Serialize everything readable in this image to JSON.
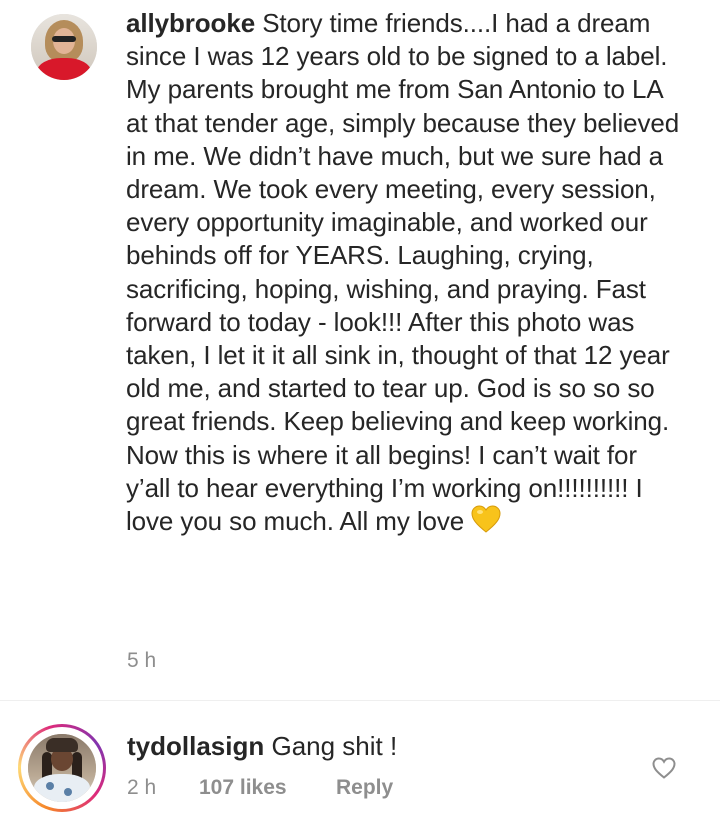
{
  "caption": {
    "username": "allybrooke",
    "text": "Story time friends....I had a dream since I was 12 years old to be signed to a label. My parents brought me from San Antonio to LA at that tender age, simply because they believed in me. We didn’t have much, but we sure had a dream. We took every meeting, every session, every opportunity imaginable, and worked our behinds off for YEARS. Laughing, crying, sacrificing, hoping, wishing, and praying. Fast forward to today - look!!! After this photo was taken, I let it it all sink in, thought of that 12 year old me, and started to tear up. God is so so so great friends. Keep believing and keep working. Now this is where it all begins! I can’t wait for y’all to hear everything I’m working on!!!!!!!!!! I love you so much. All my love",
    "emoji": "yellow-heart-icon",
    "time": "5 h",
    "avatar_icon": "avatar-allybrooke"
  },
  "comment": {
    "username": "tydollasign",
    "text": "Gang shit !",
    "time": "2 h",
    "likes": "107 likes",
    "reply_label": "Reply",
    "avatar_icon": "avatar-tydollasign",
    "like_icon": "heart-outline-icon"
  },
  "colors": {
    "text": "#262626",
    "muted": "#8e8e8e",
    "divider": "#efefef",
    "heart_yellow": "#f8c31b"
  }
}
